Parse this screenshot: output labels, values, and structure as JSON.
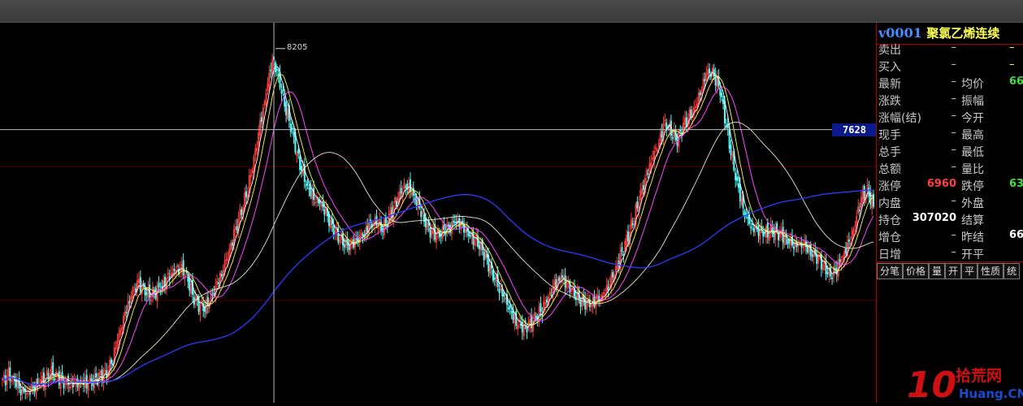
{
  "panel": {
    "code": "v0001",
    "name": "聚氯乙烯连续",
    "rows": [
      {
        "l": "卖出",
        "v": "–",
        "l2": "",
        "v2": "–",
        "c2": "yel"
      },
      {
        "l": "买入",
        "v": "–",
        "l2": "",
        "v2": "–",
        "c2": "yel"
      },
      {
        "l": "最新",
        "v": "–",
        "l2": "均价",
        "v2": "66",
        "c2": "green"
      },
      {
        "l": "涨跌",
        "v": "–",
        "l2": "振幅",
        "v2": "",
        "c2": ""
      },
      {
        "l": "涨幅(结)",
        "v": "–",
        "l2": "今开",
        "v2": "",
        "c2": ""
      },
      {
        "l": "现手",
        "v": "–",
        "l2": "最高",
        "v2": "",
        "c2": ""
      },
      {
        "l": "总手",
        "v": "–",
        "l2": "最低",
        "v2": "",
        "c2": ""
      },
      {
        "l": "总额",
        "v": "–",
        "l2": "量比",
        "v2": "",
        "c2": ""
      },
      {
        "l": "涨停",
        "v": "6960",
        "vc": "red",
        "l2": "跌停",
        "v2": "63",
        "c2": "green"
      },
      {
        "l": "内盘",
        "v": "–",
        "l2": "外盘",
        "v2": "",
        "c2": ""
      },
      {
        "l": "持仓",
        "v": "307020",
        "vc": "white",
        "l2": "结算",
        "v2": "",
        "c2": ""
      },
      {
        "l": "增仓",
        "v": "–",
        "l2": "昨结",
        "v2": "66",
        "c2": "white"
      },
      {
        "l": "日增",
        "v": "–",
        "l2": "开平",
        "v2": "",
        "c2": ""
      }
    ],
    "tabs": [
      "分笔",
      "价格",
      "量",
      "开",
      "平",
      "性质",
      "统"
    ]
  },
  "logo": {
    "num": "10",
    "cn": "拾荒网",
    "en": "Huang.CN"
  },
  "chart_data": {
    "type": "candlestick",
    "crosshair_price": "7628",
    "peak_label": "8205",
    "ylim": [
      5740,
      8360
    ],
    "closes": [
      5830,
      5880,
      5850,
      5790,
      5750,
      5770,
      5820,
      5860,
      5900,
      5870,
      5840,
      5820,
      5800,
      5810,
      5830,
      5850,
      5880,
      5900,
      6000,
      6150,
      6300,
      6450,
      6550,
      6500,
      6450,
      6480,
      6500,
      6560,
      6620,
      6660,
      6600,
      6450,
      6380,
      6350,
      6420,
      6520,
      6650,
      6780,
      6920,
      7050,
      7200,
      7400,
      7650,
      7900,
      8150,
      8000,
      7800,
      7650,
      7450,
      7300,
      7200,
      7150,
      7100,
      7000,
      6900,
      6850,
      6800,
      6820,
      6870,
      6900,
      6950,
      6950,
      6920,
      7000,
      7100,
      7200,
      7250,
      7150,
      7050,
      6950,
      6900,
      6880,
      6920,
      6950,
      6980,
      6920,
      6870,
      6850,
      6800,
      6700,
      6600,
      6500,
      6400,
      6300,
      6250,
      6230,
      6250,
      6300,
      6350,
      6420,
      6500,
      6580,
      6550,
      6480,
      6420,
      6400,
      6380,
      6400,
      6450,
      6550,
      6650,
      6750,
      6870,
      7000,
      7150,
      7300,
      7450,
      7550,
      7680,
      7600,
      7550,
      7650,
      7720,
      7800,
      7950,
      8050,
      8000,
      7900,
      7650,
      7400,
      7200,
      7050,
      6950,
      6900,
      6880,
      6900,
      6900,
      6880,
      6850,
      6820,
      6800,
      6780,
      6740,
      6720,
      6650,
      6600,
      6650,
      6720,
      6800,
      6950,
      7150,
      7200,
      7080
    ]
  }
}
